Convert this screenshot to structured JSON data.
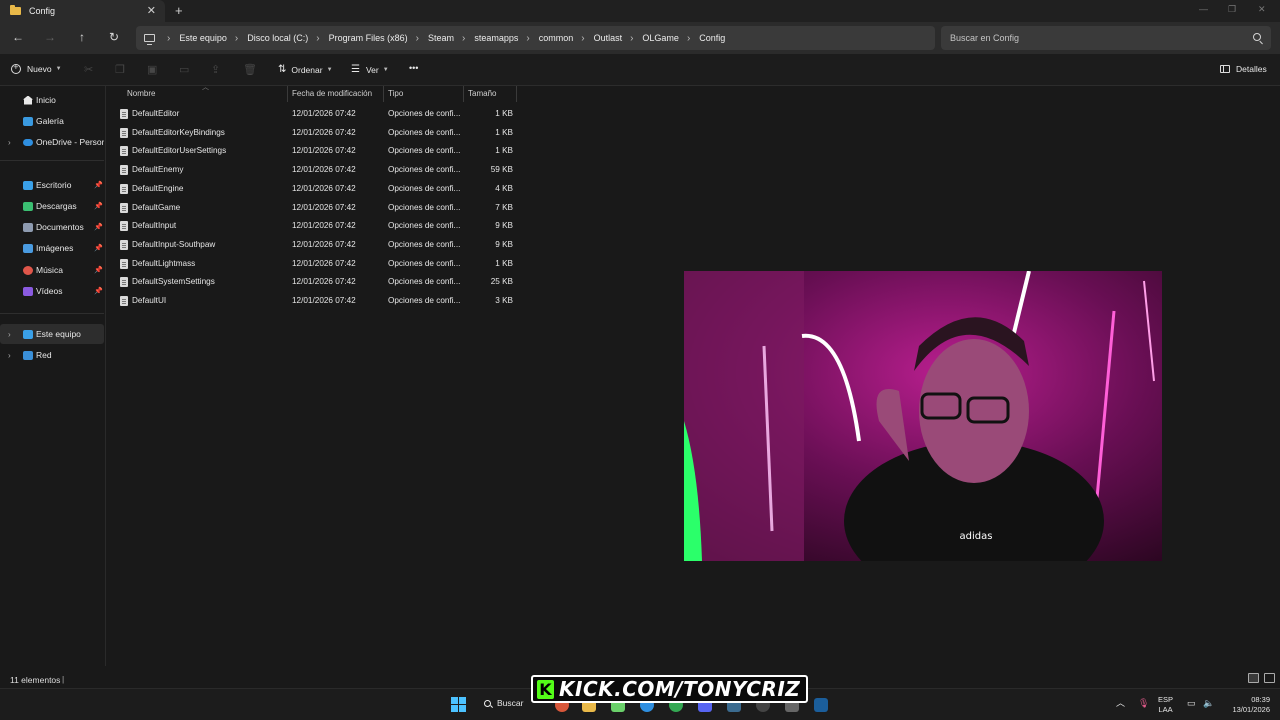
{
  "window": {
    "tab_title": "Config",
    "tab_close": "✕",
    "new_tab": "+"
  },
  "navigation": {
    "breadcrumb": [
      "Este equipo",
      "Disco local (C:)",
      "Program Files (x86)",
      "Steam",
      "steamapps",
      "common",
      "Outlast",
      "OLGame",
      "Config"
    ],
    "search_placeholder": "Buscar en Config"
  },
  "toolbar": {
    "new_label": "Nuevo",
    "sort_label": "Ordenar",
    "view_label": "Ver",
    "more_label": "•••",
    "details_label": "Detalles"
  },
  "sidebar": {
    "items": [
      {
        "label": "Inicio",
        "icon": "home-icon"
      },
      {
        "label": "Galería",
        "icon": "gallery-icon"
      },
      {
        "label": "OneDrive - Persona",
        "icon": "cloud-icon"
      },
      {
        "label": "Escritorio",
        "icon": "desktop-icon"
      },
      {
        "label": "Descargas",
        "icon": "download-icon"
      },
      {
        "label": "Documentos",
        "icon": "documents-icon"
      },
      {
        "label": "Imágenes",
        "icon": "pictures-icon"
      },
      {
        "label": "Música",
        "icon": "music-icon"
      },
      {
        "label": "Vídeos",
        "icon": "videos-icon"
      },
      {
        "label": "Este equipo",
        "icon": "pc-icon"
      },
      {
        "label": "Red",
        "icon": "network-icon"
      }
    ]
  },
  "file_list": {
    "columns": [
      "Nombre",
      "Fecha de modificación",
      "Tipo",
      "Tamaño"
    ],
    "rows": [
      {
        "name": "DefaultEditor",
        "date": "12/01/2026 07:42",
        "type": "Opciones de confi...",
        "size": "1 KB"
      },
      {
        "name": "DefaultEditorKeyBindings",
        "date": "12/01/2026 07:42",
        "type": "Opciones de confi...",
        "size": "1 KB"
      },
      {
        "name": "DefaultEditorUserSettings",
        "date": "12/01/2026 07:42",
        "type": "Opciones de confi...",
        "size": "1 KB"
      },
      {
        "name": "DefaultEnemy",
        "date": "12/01/2026 07:42",
        "type": "Opciones de confi...",
        "size": "59 KB"
      },
      {
        "name": "DefaultEngine",
        "date": "12/01/2026 07:42",
        "type": "Opciones de confi...",
        "size": "4 KB"
      },
      {
        "name": "DefaultGame",
        "date": "12/01/2026 07:42",
        "type": "Opciones de confi...",
        "size": "7 KB"
      },
      {
        "name": "DefaultInput",
        "date": "12/01/2026 07:42",
        "type": "Opciones de confi...",
        "size": "9 KB"
      },
      {
        "name": "DefaultInput-Southpaw",
        "date": "12/01/2026 07:42",
        "type": "Opciones de confi...",
        "size": "9 KB"
      },
      {
        "name": "DefaultLightmass",
        "date": "12/01/2026 07:42",
        "type": "Opciones de confi...",
        "size": "1 KB"
      },
      {
        "name": "DefaultSystemSettings",
        "date": "12/01/2026 07:42",
        "type": "Opciones de confi...",
        "size": "25 KB"
      },
      {
        "name": "DefaultUI",
        "date": "12/01/2026 07:42",
        "type": "Opciones de confi...",
        "size": "3 KB"
      }
    ]
  },
  "status": {
    "item_count": "11 elementos"
  },
  "overlay": {
    "kick_logo": "K",
    "kick_text": "KICK.COM/TONYCRIZ"
  },
  "taskbar": {
    "search_label": "Buscar",
    "lang_top": "ESP",
    "lang_bottom": "LAA",
    "time": "08:39",
    "date": "13/01/2026"
  },
  "colors": {
    "accent": "#4cc2ff",
    "kick_green": "#53fc18",
    "folder": "#e9b949"
  }
}
